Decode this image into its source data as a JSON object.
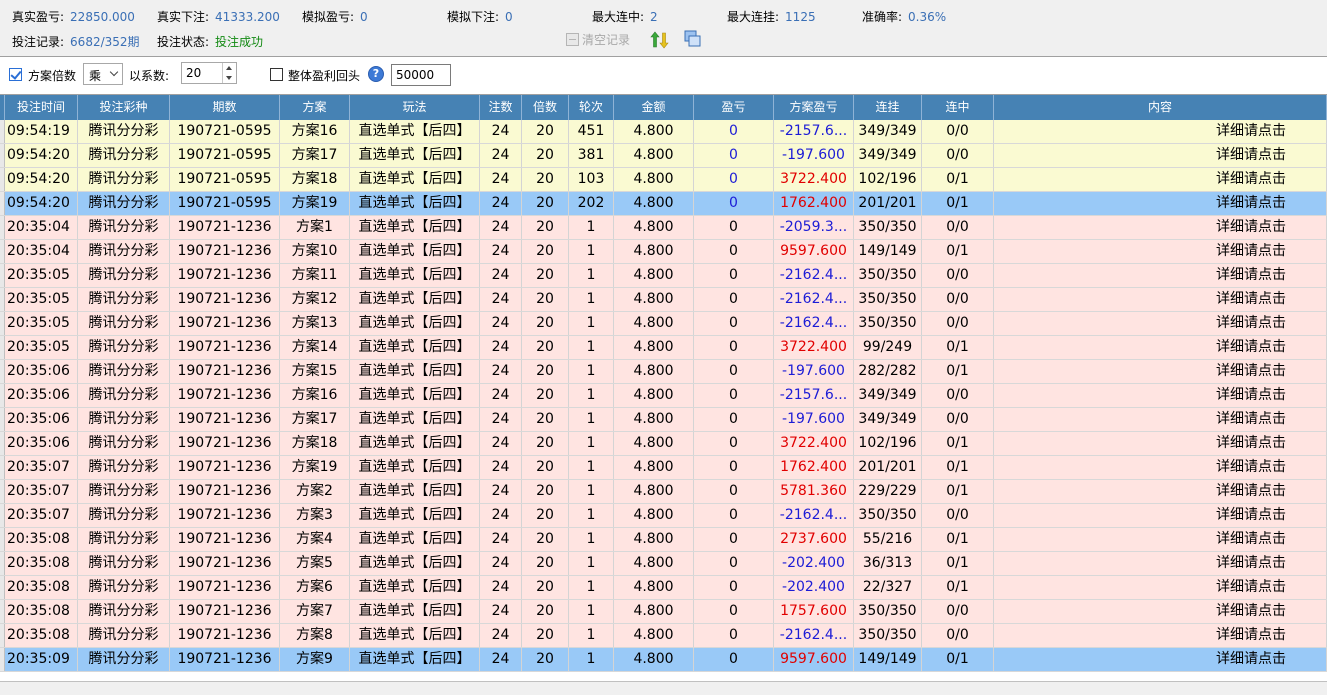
{
  "stats": {
    "real_profit": {
      "label": "真实盈亏:",
      "value": "22850.000"
    },
    "real_bet": {
      "label": "真实下注:",
      "value": "41333.200"
    },
    "sim_profit": {
      "label": "模拟盈亏:",
      "value": "0"
    },
    "sim_bet": {
      "label": "模拟下注:",
      "value": "0"
    },
    "max_win_streak": {
      "label": "最大连中:",
      "value": "2"
    },
    "max_loss_streak": {
      "label": "最大连挂:",
      "value": "1125"
    },
    "accuracy": {
      "label": "准确率:",
      "value": "0.36%"
    },
    "bet_record": {
      "label": "投注记录:",
      "value": "6682/352期"
    },
    "bet_status": {
      "label": "投注状态:",
      "value": "投注成功"
    },
    "clear_label": "清空记录"
  },
  "options": {
    "plan_multiplier_label": "方案倍数",
    "operator_value": "乘",
    "coef_label": "以系数:",
    "coef_value": "20",
    "overall_label": "整体盈利回头",
    "overall_value": "50000"
  },
  "columns": [
    "投注时间",
    "投注彩种",
    "期数",
    "方案",
    "玩法",
    "注数",
    "倍数",
    "轮次",
    "金额",
    "盈亏",
    "方案盈亏",
    "连挂",
    "连中",
    "内容"
  ],
  "rows": [
    {
      "time": "09:54:19",
      "lottery": "腾讯分分彩",
      "issue": "190721-0595",
      "plan": "方案16",
      "play": "直选单式【后四】",
      "count": "24",
      "mult": "20",
      "round": "451",
      "amount": "4.800",
      "pl": "0",
      "plan_pl": "-2157.6...",
      "lose": "349/349",
      "win": "0/0",
      "content": "详细请点击",
      "bg": "yellow",
      "pl_color": "navy",
      "plan_pl_color": "navy"
    },
    {
      "time": "09:54:20",
      "lottery": "腾讯分分彩",
      "issue": "190721-0595",
      "plan": "方案17",
      "play": "直选单式【后四】",
      "count": "24",
      "mult": "20",
      "round": "381",
      "amount": "4.800",
      "pl": "0",
      "plan_pl": "-197.600",
      "lose": "349/349",
      "win": "0/0",
      "content": "详细请点击",
      "bg": "yellow",
      "pl_color": "navy",
      "plan_pl_color": "navy"
    },
    {
      "time": "09:54:20",
      "lottery": "腾讯分分彩",
      "issue": "190721-0595",
      "plan": "方案18",
      "play": "直选单式【后四】",
      "count": "24",
      "mult": "20",
      "round": "103",
      "amount": "4.800",
      "pl": "0",
      "plan_pl": "3722.400",
      "lose": "102/196",
      "win": "0/1",
      "content": "详细请点击",
      "bg": "yellow",
      "pl_color": "navy",
      "plan_pl_color": "red"
    },
    {
      "time": "09:54:20",
      "lottery": "腾讯分分彩",
      "issue": "190721-0595",
      "plan": "方案19",
      "play": "直选单式【后四】",
      "count": "24",
      "mult": "20",
      "round": "202",
      "amount": "4.800",
      "pl": "0",
      "plan_pl": "1762.400",
      "lose": "201/201",
      "win": "0/1",
      "content": "详细请点击",
      "bg": "blue",
      "pl_color": "navy",
      "plan_pl_color": "red"
    },
    {
      "time": "20:35:04",
      "lottery": "腾讯分分彩",
      "issue": "190721-1236",
      "plan": "方案1",
      "play": "直选单式【后四】",
      "count": "24",
      "mult": "20",
      "round": "1",
      "amount": "4.800",
      "pl": "0",
      "plan_pl": "-2059.3...",
      "lose": "350/350",
      "win": "0/0",
      "content": "详细请点击",
      "bg": "pink",
      "pl_color": "",
      "plan_pl_color": "navy"
    },
    {
      "time": "20:35:04",
      "lottery": "腾讯分分彩",
      "issue": "190721-1236",
      "plan": "方案10",
      "play": "直选单式【后四】",
      "count": "24",
      "mult": "20",
      "round": "1",
      "amount": "4.800",
      "pl": "0",
      "plan_pl": "9597.600",
      "lose": "149/149",
      "win": "0/1",
      "content": "详细请点击",
      "bg": "pink",
      "pl_color": "",
      "plan_pl_color": "red"
    },
    {
      "time": "20:35:05",
      "lottery": "腾讯分分彩",
      "issue": "190721-1236",
      "plan": "方案11",
      "play": "直选单式【后四】",
      "count": "24",
      "mult": "20",
      "round": "1",
      "amount": "4.800",
      "pl": "0",
      "plan_pl": "-2162.4...",
      "lose": "350/350",
      "win": "0/0",
      "content": "详细请点击",
      "bg": "pink",
      "pl_color": "",
      "plan_pl_color": "navy"
    },
    {
      "time": "20:35:05",
      "lottery": "腾讯分分彩",
      "issue": "190721-1236",
      "plan": "方案12",
      "play": "直选单式【后四】",
      "count": "24",
      "mult": "20",
      "round": "1",
      "amount": "4.800",
      "pl": "0",
      "plan_pl": "-2162.4...",
      "lose": "350/350",
      "win": "0/0",
      "content": "详细请点击",
      "bg": "pink",
      "pl_color": "",
      "plan_pl_color": "navy"
    },
    {
      "time": "20:35:05",
      "lottery": "腾讯分分彩",
      "issue": "190721-1236",
      "plan": "方案13",
      "play": "直选单式【后四】",
      "count": "24",
      "mult": "20",
      "round": "1",
      "amount": "4.800",
      "pl": "0",
      "plan_pl": "-2162.4...",
      "lose": "350/350",
      "win": "0/0",
      "content": "详细请点击",
      "bg": "pink",
      "pl_color": "",
      "plan_pl_color": "navy"
    },
    {
      "time": "20:35:05",
      "lottery": "腾讯分分彩",
      "issue": "190721-1236",
      "plan": "方案14",
      "play": "直选单式【后四】",
      "count": "24",
      "mult": "20",
      "round": "1",
      "amount": "4.800",
      "pl": "0",
      "plan_pl": "3722.400",
      "lose": "99/249",
      "win": "0/1",
      "content": "详细请点击",
      "bg": "pink",
      "pl_color": "",
      "plan_pl_color": "red"
    },
    {
      "time": "20:35:06",
      "lottery": "腾讯分分彩",
      "issue": "190721-1236",
      "plan": "方案15",
      "play": "直选单式【后四】",
      "count": "24",
      "mult": "20",
      "round": "1",
      "amount": "4.800",
      "pl": "0",
      "plan_pl": "-197.600",
      "lose": "282/282",
      "win": "0/1",
      "content": "详细请点击",
      "bg": "pink",
      "pl_color": "",
      "plan_pl_color": "navy"
    },
    {
      "time": "20:35:06",
      "lottery": "腾讯分分彩",
      "issue": "190721-1236",
      "plan": "方案16",
      "play": "直选单式【后四】",
      "count": "24",
      "mult": "20",
      "round": "1",
      "amount": "4.800",
      "pl": "0",
      "plan_pl": "-2157.6...",
      "lose": "349/349",
      "win": "0/0",
      "content": "详细请点击",
      "bg": "pink",
      "pl_color": "",
      "plan_pl_color": "navy"
    },
    {
      "time": "20:35:06",
      "lottery": "腾讯分分彩",
      "issue": "190721-1236",
      "plan": "方案17",
      "play": "直选单式【后四】",
      "count": "24",
      "mult": "20",
      "round": "1",
      "amount": "4.800",
      "pl": "0",
      "plan_pl": "-197.600",
      "lose": "349/349",
      "win": "0/0",
      "content": "详细请点击",
      "bg": "pink",
      "pl_color": "",
      "plan_pl_color": "navy"
    },
    {
      "time": "20:35:06",
      "lottery": "腾讯分分彩",
      "issue": "190721-1236",
      "plan": "方案18",
      "play": "直选单式【后四】",
      "count": "24",
      "mult": "20",
      "round": "1",
      "amount": "4.800",
      "pl": "0",
      "plan_pl": "3722.400",
      "lose": "102/196",
      "win": "0/1",
      "content": "详细请点击",
      "bg": "pink",
      "pl_color": "",
      "plan_pl_color": "red"
    },
    {
      "time": "20:35:07",
      "lottery": "腾讯分分彩",
      "issue": "190721-1236",
      "plan": "方案19",
      "play": "直选单式【后四】",
      "count": "24",
      "mult": "20",
      "round": "1",
      "amount": "4.800",
      "pl": "0",
      "plan_pl": "1762.400",
      "lose": "201/201",
      "win": "0/1",
      "content": "详细请点击",
      "bg": "pink",
      "pl_color": "",
      "plan_pl_color": "red"
    },
    {
      "time": "20:35:07",
      "lottery": "腾讯分分彩",
      "issue": "190721-1236",
      "plan": "方案2",
      "play": "直选单式【后四】",
      "count": "24",
      "mult": "20",
      "round": "1",
      "amount": "4.800",
      "pl": "0",
      "plan_pl": "5781.360",
      "lose": "229/229",
      "win": "0/1",
      "content": "详细请点击",
      "bg": "pink",
      "pl_color": "",
      "plan_pl_color": "red"
    },
    {
      "time": "20:35:07",
      "lottery": "腾讯分分彩",
      "issue": "190721-1236",
      "plan": "方案3",
      "play": "直选单式【后四】",
      "count": "24",
      "mult": "20",
      "round": "1",
      "amount": "4.800",
      "pl": "0",
      "plan_pl": "-2162.4...",
      "lose": "350/350",
      "win": "0/0",
      "content": "详细请点击",
      "bg": "pink",
      "pl_color": "",
      "plan_pl_color": "navy"
    },
    {
      "time": "20:35:08",
      "lottery": "腾讯分分彩",
      "issue": "190721-1236",
      "plan": "方案4",
      "play": "直选单式【后四】",
      "count": "24",
      "mult": "20",
      "round": "1",
      "amount": "4.800",
      "pl": "0",
      "plan_pl": "2737.600",
      "lose": "55/216",
      "win": "0/1",
      "content": "详细请点击",
      "bg": "pink",
      "pl_color": "",
      "plan_pl_color": "red"
    },
    {
      "time": "20:35:08",
      "lottery": "腾讯分分彩",
      "issue": "190721-1236",
      "plan": "方案5",
      "play": "直选单式【后四】",
      "count": "24",
      "mult": "20",
      "round": "1",
      "amount": "4.800",
      "pl": "0",
      "plan_pl": "-202.400",
      "lose": "36/313",
      "win": "0/1",
      "content": "详细请点击",
      "bg": "pink",
      "pl_color": "",
      "plan_pl_color": "navy"
    },
    {
      "time": "20:35:08",
      "lottery": "腾讯分分彩",
      "issue": "190721-1236",
      "plan": "方案6",
      "play": "直选单式【后四】",
      "count": "24",
      "mult": "20",
      "round": "1",
      "amount": "4.800",
      "pl": "0",
      "plan_pl": "-202.400",
      "lose": "22/327",
      "win": "0/1",
      "content": "详细请点击",
      "bg": "pink",
      "pl_color": "",
      "plan_pl_color": "navy"
    },
    {
      "time": "20:35:08",
      "lottery": "腾讯分分彩",
      "issue": "190721-1236",
      "plan": "方案7",
      "play": "直选单式【后四】",
      "count": "24",
      "mult": "20",
      "round": "1",
      "amount": "4.800",
      "pl": "0",
      "plan_pl": "1757.600",
      "lose": "350/350",
      "win": "0/0",
      "content": "详细请点击",
      "bg": "pink",
      "pl_color": "",
      "plan_pl_color": "red"
    },
    {
      "time": "20:35:08",
      "lottery": "腾讯分分彩",
      "issue": "190721-1236",
      "plan": "方案8",
      "play": "直选单式【后四】",
      "count": "24",
      "mult": "20",
      "round": "1",
      "amount": "4.800",
      "pl": "0",
      "plan_pl": "-2162.4...",
      "lose": "350/350",
      "win": "0/0",
      "content": "详细请点击",
      "bg": "pink",
      "pl_color": "",
      "plan_pl_color": "navy"
    },
    {
      "time": "20:35:09",
      "lottery": "腾讯分分彩",
      "issue": "190721-1236",
      "plan": "方案9",
      "play": "直选单式【后四】",
      "count": "24",
      "mult": "20",
      "round": "1",
      "amount": "4.800",
      "pl": "0",
      "plan_pl": "9597.600",
      "lose": "149/149",
      "win": "0/1",
      "content": "详细请点击",
      "bg": "blue",
      "pl_color": "",
      "plan_pl_color": "red"
    }
  ]
}
